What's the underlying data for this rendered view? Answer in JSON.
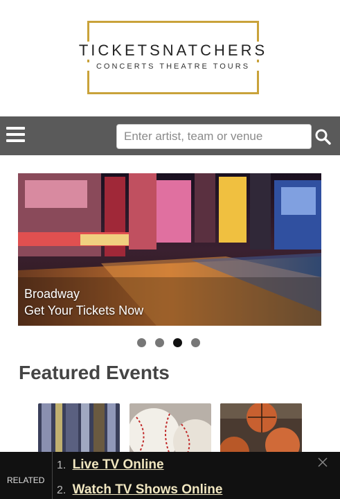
{
  "logo": {
    "title": "TICKETSNATCHERS",
    "tagline": "CONCERTS THEATRE TOURS",
    "accent_color": "#c9a23a"
  },
  "nav": {
    "menu_icon": "hamburger-icon",
    "search_placeholder": "Enter artist, team or venue",
    "search_value": "",
    "search_icon": "search-icon",
    "bar_color": "#5a5a5a"
  },
  "hero": {
    "caption_line1": "Broadway",
    "caption_line2": "Get Your Tickets Now",
    "slide_count": 4,
    "active_slide": 3
  },
  "featured": {
    "title": "Featured Events",
    "thumbnails": [
      "event-image-1",
      "baseball-image",
      "basketball-image"
    ]
  },
  "ad": {
    "label": "RELATED",
    "items": [
      {
        "number": "1.",
        "text": "Live TV Online"
      },
      {
        "number": "2.",
        "text": "Watch TV Shows Online"
      }
    ],
    "close_icon": "close-icon"
  }
}
